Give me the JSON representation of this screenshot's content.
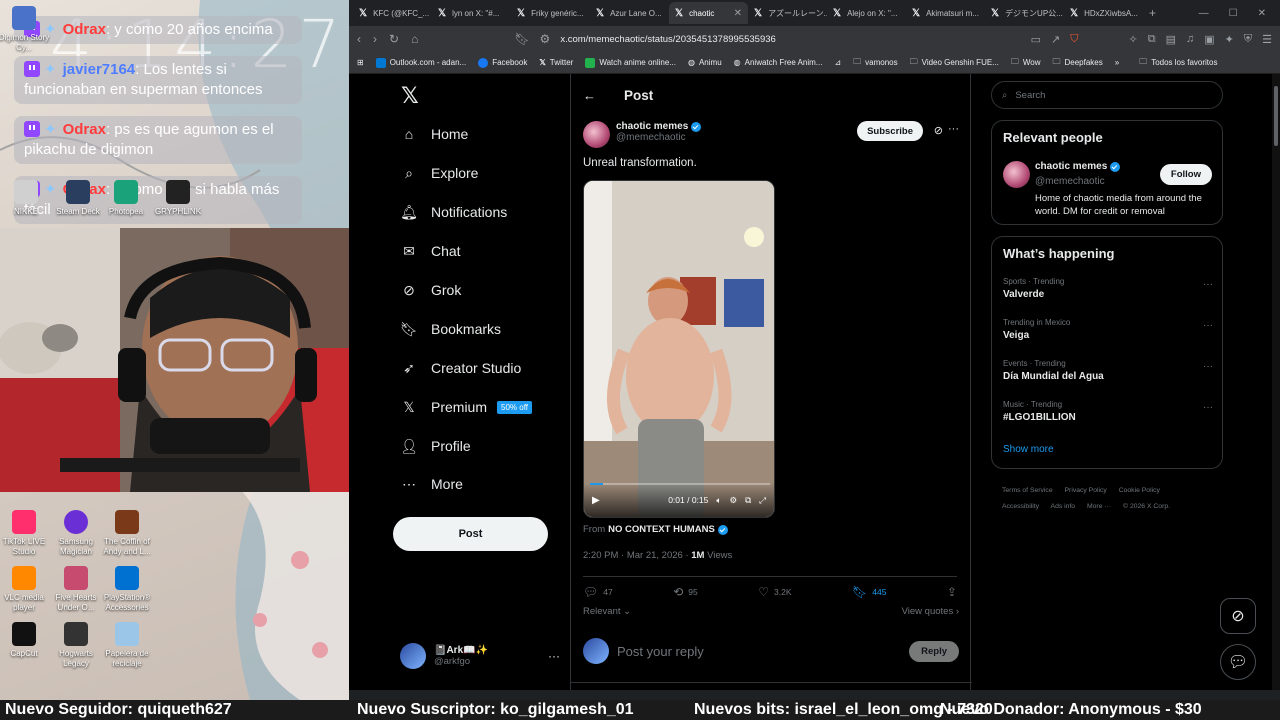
{
  "stream": {
    "clock": "4:14:27",
    "chat": [
      {
        "user": "Odrax",
        "user_color": "#ff3b3b",
        "text": ": y como 20 años encima"
      },
      {
        "user": "javier7164",
        "user_color": "#4f7dff",
        "text": ": Los lentes si funcionaban en superman entonces"
      },
      {
        "user": "Odrax",
        "user_color": "#ff3b3b",
        "text": ": ps es que agumon es el pikachu de digimon"
      },
      {
        "user": "Odrax",
        "user_color": "#ff3b3b",
        "text": ": y como ese si habla más fácil"
      }
    ],
    "desktop_icons": [
      {
        "label": "Digimon Story Cy...",
        "color": "#4a72c9"
      },
      {
        "label": "NIKKE",
        "color": "#d0d0d0"
      },
      {
        "label": "Steam Deck",
        "color": "#2a3f5f"
      },
      {
        "label": "Photopea",
        "color": "#1aa37a"
      },
      {
        "label": "GRYPHLINK",
        "color": "#222222"
      },
      {
        "label": "TikTok LIVE Studio",
        "color": "#ff2f6d"
      },
      {
        "label": "Samsung Magician",
        "color": "#6b2fd6"
      },
      {
        "label": "The Coffin of Andy and L...",
        "color": "#7a3a1a"
      },
      {
        "label": "VLC media player",
        "color": "#ff8800"
      },
      {
        "label": "Five Hearts Under O...",
        "color": "#c64b6e"
      },
      {
        "label": "PlayStation® Accessories",
        "color": "#0070d1"
      },
      {
        "label": "CapCut",
        "color": "#111111"
      },
      {
        "label": "Hogwarts Legacy",
        "color": "#333333"
      },
      {
        "label": "Papelera de reciclaje",
        "color": "#9cc6e8"
      }
    ],
    "ticker": [
      "Nuevo Seguidor: quiqueth627",
      "Nuevo Suscriptor: ko_gilgamesh_01",
      "Nuevos bits: israel_el_leon_omg - 7320",
      "Nuevo Donador: Anonymous - $30"
    ]
  },
  "browser": {
    "tabs": [
      {
        "label": "KFC (@KFC_..."
      },
      {
        "label": "lyn on X: \"#..."
      },
      {
        "label": "Friky genéric..."
      },
      {
        "label": "Azur Lane O..."
      },
      {
        "label": "chaotic",
        "active": true
      },
      {
        "label": "アズールレーン..."
      },
      {
        "label": "Alejo on X: \"..."
      },
      {
        "label": "Akimatsuri m..."
      },
      {
        "label": "デジモンUP公..."
      },
      {
        "label": "HDxZXiwbsA..."
      }
    ],
    "url": "x.com/memechaotic/status/2035451378995535936",
    "bookmarks": [
      {
        "label": "Outlook.com - adan...",
        "color": "#0078d4"
      },
      {
        "label": "Facebook",
        "color": "#1877f2"
      },
      {
        "label": "Twitter",
        "color": "#ffffff"
      },
      {
        "label": "Watch anime online...",
        "color": "#22b14c"
      },
      {
        "label": "Animu",
        "color": "#888888"
      },
      {
        "label": "Aniwatch Free Anim...",
        "color": "#aaaaaa"
      },
      {
        "label": "vamonos",
        "color": "folder"
      },
      {
        "label": "Video Genshin FUE...",
        "color": "folder"
      },
      {
        "label": "Wow",
        "color": "folder"
      },
      {
        "label": "Deepfakes",
        "color": "folder"
      }
    ],
    "bookmarks_all": "Todos los favoritos"
  },
  "x": {
    "nav": [
      {
        "label": "Home",
        "icon": "home-icon",
        "glyph": "⌂"
      },
      {
        "label": "Explore",
        "icon": "search-icon",
        "glyph": "⌕"
      },
      {
        "label": "Notifications",
        "icon": "bell-icon",
        "glyph": "🔔︎"
      },
      {
        "label": "Chat",
        "icon": "mail-icon",
        "glyph": "✉"
      },
      {
        "label": "Grok",
        "icon": "grok-icon",
        "glyph": "⊘"
      },
      {
        "label": "Bookmarks",
        "icon": "bookmark-icon",
        "glyph": "🔖︎"
      },
      {
        "label": "Creator Studio",
        "icon": "rocket-icon",
        "glyph": "➶"
      },
      {
        "label": "Premium",
        "icon": "x-premium-icon",
        "glyph": "𝕏"
      },
      {
        "label": "Profile",
        "icon": "person-icon",
        "glyph": "👤︎"
      },
      {
        "label": "More",
        "icon": "more-circle-icon",
        "glyph": "⋯"
      }
    ],
    "premium_badge": "50% off",
    "post_button": "Post",
    "account": {
      "name": "📓Ark📖✨",
      "handle": "@arkfgo"
    },
    "header_title": "Post",
    "post": {
      "author_name": "chaotic memes",
      "author_handle": "@memechaotic",
      "subscribe_label": "Subscribe",
      "text": "Unreal transformation.",
      "video_time": "0:01 / 0:15",
      "video_progress": 0.07,
      "from_label": "From",
      "from_source": "NO CONTEXT HUMANS",
      "time": "2:20 PM · Mar 21, 2026 · ",
      "views": "1M",
      "views_label": " Views",
      "replies": "47",
      "reposts": "95",
      "likes": "3.2K",
      "bookmarks": "445",
      "sort_label": "Relevant ⌄",
      "view_quotes": "View quotes ›",
      "reply_placeholder": "Post your reply",
      "reply_button": "Reply"
    },
    "search_placeholder": "Search",
    "relevant": {
      "title": "Relevant people",
      "name": "chaotic memes",
      "handle": "@memechaotic",
      "follow": "Follow",
      "bio": "Home of chaotic media from around the world. DM for credit or removal"
    },
    "happening": {
      "title": "What’s happening",
      "trends": [
        {
          "category": "Sports · Trending",
          "title": "Valverde"
        },
        {
          "category": "Trending in Mexico",
          "title": "Veiga"
        },
        {
          "category": "Events · Trending",
          "title": "Día Mundial del Agua"
        },
        {
          "category": "Music · Trending",
          "title": "#LGO1BILLION"
        }
      ],
      "show_more": "Show more"
    },
    "footer_links": [
      "Terms of Service",
      "Privacy Policy",
      "Cookie Policy",
      "Accessibility",
      "Ads info",
      "More ···",
      "© 2026 X Corp."
    ]
  }
}
